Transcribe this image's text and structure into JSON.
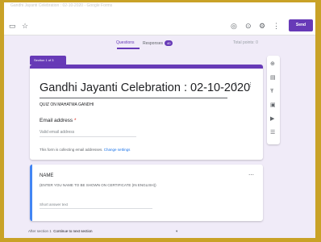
{
  "topbar": {
    "doc_title": "Gandhi Jayanti Celebration : 02-10-2020 - Google Forms",
    "send_label": "Send",
    "icons": [
      "folder-icon",
      "star-icon",
      "palette-icon",
      "preview-icon",
      "settings-icon"
    ]
  },
  "tabs": {
    "questions": "Questions",
    "responses": "Responses",
    "responses_count": "40",
    "total_points": "Total points: 0"
  },
  "section": {
    "tag": "Section 1 of 3",
    "form_title": "Gandhi Jayanti Celebration : 02-10-2020",
    "description": "QUIZ ON MAHATMA GANDHI"
  },
  "email_question": {
    "label": "Email address",
    "required_mark": "*",
    "placeholder": "Valid email address",
    "note": "This form is collecting email addresses.",
    "change_link": "Change settings"
  },
  "name_question": {
    "label": "NAME",
    "description": "(ENTER YOU NAME TO BE SHOWN ON CERTIFICATE (IN ENGLISH))",
    "placeholder": "Short answer text"
  },
  "footer": {
    "after_section_prefix": "After section 1",
    "after_section_value": "Continue to next section"
  },
  "side_toolbar": [
    "add-question-icon",
    "import-questions-icon",
    "add-title-icon",
    "add-image-icon",
    "add-video-icon",
    "add-section-icon"
  ],
  "colors": {
    "accent": "#673ab7",
    "background": "#f0ebf8",
    "outer_border": "#c9a227",
    "active_question": "#4285f4"
  }
}
